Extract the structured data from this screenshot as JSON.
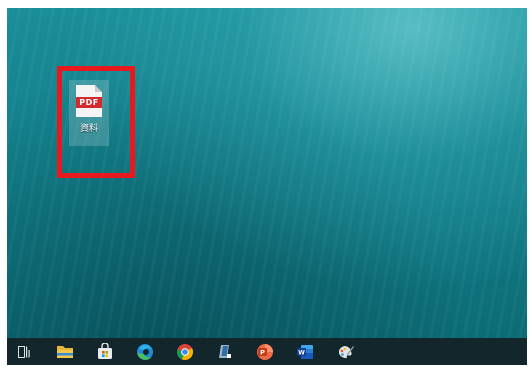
{
  "desktop": {
    "icons": [
      {
        "name": "pdf-file",
        "badge": "PDF",
        "label": "資料",
        "icon": "pdf-file-icon",
        "highlighted": true
      }
    ]
  },
  "colors": {
    "highlight": "#e8181f",
    "taskbar": "#13262c",
    "pdf_red": "#d42a2f"
  },
  "taskbar": {
    "items": [
      {
        "icon": "task-view-icon"
      },
      {
        "icon": "file-explorer-icon"
      },
      {
        "icon": "microsoft-store-icon"
      },
      {
        "icon": "edge-icon"
      },
      {
        "icon": "chrome-icon"
      },
      {
        "icon": "app-icon"
      },
      {
        "icon": "powerpoint-icon"
      },
      {
        "icon": "word-icon"
      },
      {
        "icon": "paint-icon"
      }
    ]
  }
}
